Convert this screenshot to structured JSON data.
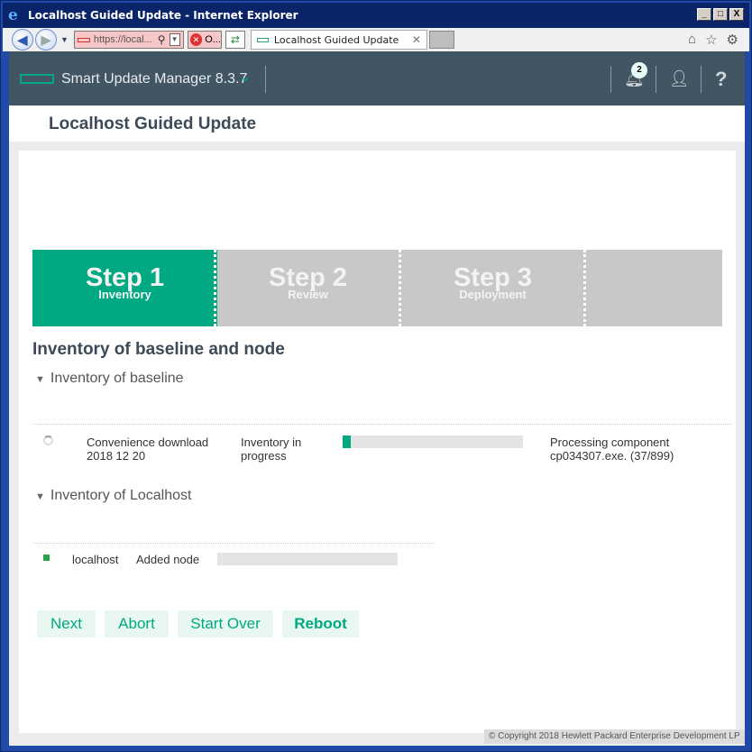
{
  "browser": {
    "window_title": "Localhost Guided Update - Internet Explorer",
    "address_text": "https://local...",
    "cert_text": "O...",
    "tab_title": "Localhost Guided Update",
    "min_glyph": "_",
    "max_glyph": "□",
    "close_glyph": "X",
    "tab_close_glyph": "✕",
    "icons": [
      "home-icon",
      "favorites-icon",
      "settings-icon"
    ]
  },
  "app": {
    "name": "Smart Update Manager 8.3.7",
    "notification_count": "2",
    "help_glyph": "?",
    "page_title": "Localhost Guided Update"
  },
  "steps": [
    {
      "title": "Step 1",
      "label": "Inventory",
      "active": true
    },
    {
      "title": "Step 2",
      "label": "Review",
      "active": false
    },
    {
      "title": "Step 3",
      "label": "Deployment",
      "active": false
    }
  ],
  "content": {
    "section_title": "Inventory of baseline and node",
    "baseline_heading": "Inventory of baseline",
    "baseline_row": {
      "name_line1": "Convenience download",
      "name_line2": "2018 12 20",
      "status_line1": "Inventory in",
      "status_line2": "progress",
      "progress": 0.045,
      "detail_line1": "Processing component",
      "detail_line2": "cp034307.exe. (37/899)"
    },
    "localhost_heading": "Inventory of Localhost",
    "localhost_row": {
      "name": "localhost",
      "status": "Added node",
      "progress": 0
    }
  },
  "buttons": {
    "next": "Next",
    "abort": "Abort",
    "start_over": "Start Over",
    "reboot": "Reboot"
  },
  "footer": "© Copyright 2018 Hewlett Packard Enterprise Development LP",
  "colors": {
    "accent": "#01a982",
    "header_bg": "#425563",
    "inactive_step": "#c8c8c8"
  }
}
